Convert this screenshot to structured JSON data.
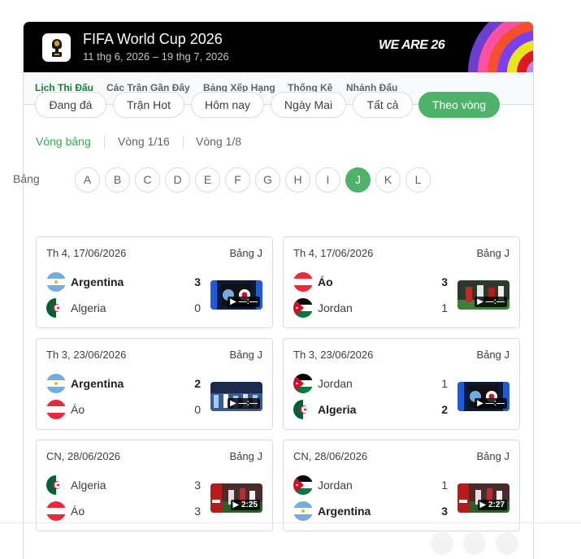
{
  "header": {
    "title": "FIFA World Cup 2026",
    "subtitle": "11 thg 6, 2026 – 19 thg 7, 2026",
    "slogan": "WE ARE 26"
  },
  "tabs": [
    {
      "label": "Lịch Thi Đấu",
      "active": true
    },
    {
      "label": "Các Trận Gần Đây",
      "active": false
    },
    {
      "label": "Bảng Xếp Hạng",
      "active": false
    },
    {
      "label": "Thống Kê",
      "active": false
    },
    {
      "label": "Nhánh Đấu",
      "active": false
    }
  ],
  "filters": [
    {
      "label": "Đang đá",
      "active": false
    },
    {
      "label": "Trận Hot",
      "active": false
    },
    {
      "label": "Hôm nay",
      "active": false
    },
    {
      "label": "Ngày Mai",
      "active": false
    },
    {
      "label": "Tất cả",
      "active": false
    },
    {
      "label": "Theo vòng",
      "active": true
    }
  ],
  "rounds": [
    {
      "label": "Vòng bảng",
      "active": true
    },
    {
      "label": "Vòng 1/16",
      "active": false
    },
    {
      "label": "Vòng 1/8",
      "active": false
    }
  ],
  "groups": {
    "label": "Bảng",
    "letters": [
      "A",
      "B",
      "C",
      "D",
      "E",
      "F",
      "G",
      "H",
      "I",
      "J",
      "K",
      "L"
    ],
    "active": "J"
  },
  "matches": [
    {
      "date": "Th 4, 17/06/2026",
      "group": "Bảng J",
      "home": {
        "name": "Argentina",
        "flag": "argentina",
        "score": "3",
        "win": true
      },
      "away": {
        "name": "Algeria",
        "flag": "algeria",
        "score": "0",
        "win": false
      },
      "thumb_duration": "—:—",
      "thumb_style": "flags-argentina-algeria"
    },
    {
      "date": "Th 4, 17/06/2026",
      "group": "Bảng J",
      "home": {
        "name": "Áo",
        "flag": "austria",
        "score": "3",
        "win": true
      },
      "away": {
        "name": "Jordan",
        "flag": "jordan",
        "score": "1",
        "win": false
      },
      "thumb_duration": "—:—",
      "thumb_style": "match-photo"
    },
    {
      "date": "Th 3, 23/06/2026",
      "group": "Bảng J",
      "home": {
        "name": "Argentina",
        "flag": "argentina",
        "score": "2",
        "win": true
      },
      "away": {
        "name": "Áo",
        "flag": "austria",
        "score": "0",
        "win": false
      },
      "thumb_duration": "—:—",
      "thumb_style": "stadium-photo"
    },
    {
      "date": "Th 3, 23/06/2026",
      "group": "Bảng J",
      "home": {
        "name": "Jordan",
        "flag": "jordan",
        "score": "1",
        "win": false
      },
      "away": {
        "name": "Algeria",
        "flag": "algeria",
        "score": "2",
        "win": true
      },
      "thumb_duration": "—:—",
      "thumb_style": "flags-jordan-algeria"
    },
    {
      "date": "CN, 28/06/2026",
      "group": "Bảng J",
      "home": {
        "name": "Algeria",
        "flag": "algeria",
        "score": "3",
        "win": false
      },
      "away": {
        "name": "Áo",
        "flag": "austria",
        "score": "3",
        "win": false
      },
      "thumb_duration": "2:25",
      "thumb_style": "highlight-photo"
    },
    {
      "date": "CN, 28/06/2026",
      "group": "Bảng J",
      "home": {
        "name": "Jordan",
        "flag": "jordan",
        "score": "1",
        "win": false
      },
      "away": {
        "name": "Argentina",
        "flag": "argentina",
        "score": "3",
        "win": true
      },
      "thumb_duration": "2:27",
      "thumb_style": "highlight-photo"
    }
  ],
  "colors": {
    "accent_green": "#4db36a",
    "tab_active": "#188038",
    "header_bg": "#000000"
  }
}
